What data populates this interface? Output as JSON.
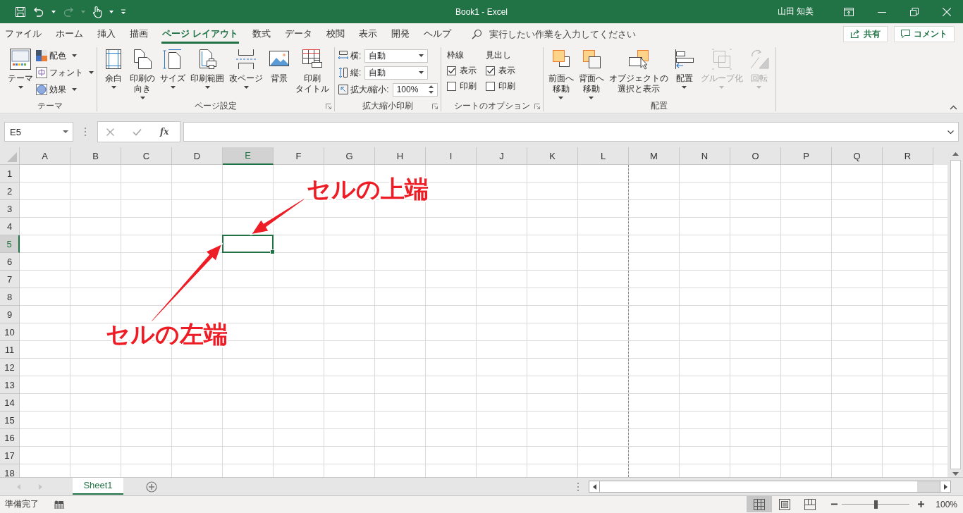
{
  "window": {
    "title": "Book1  -  Excel",
    "user": "山田 知美"
  },
  "ribbon_tabs": [
    {
      "label": "ファイル",
      "selected": false
    },
    {
      "label": "ホーム",
      "selected": false
    },
    {
      "label": "挿入",
      "selected": false
    },
    {
      "label": "描画",
      "selected": false
    },
    {
      "label": "ページ レイアウト",
      "selected": true
    },
    {
      "label": "数式",
      "selected": false
    },
    {
      "label": "データ",
      "selected": false
    },
    {
      "label": "校閲",
      "selected": false
    },
    {
      "label": "表示",
      "selected": false
    },
    {
      "label": "開発",
      "selected": false
    },
    {
      "label": "ヘルプ",
      "selected": false
    }
  ],
  "tell_me": {
    "placeholder": "実行したい作業を入力してください"
  },
  "share_button": "共有",
  "comment_button": "コメント",
  "ribbon_groups": [
    {
      "label": "テーマ",
      "launcher": false,
      "items": [
        {
          "kind": "large",
          "lines": [
            "テーマ"
          ],
          "dropdown": true,
          "disabled": false
        },
        {
          "kind": "stack",
          "items": [
            {
              "kind": "small",
              "label": "配色",
              "dropdown": true
            },
            {
              "kind": "small",
              "label": "フォント",
              "dropdown": true
            },
            {
              "kind": "small",
              "label": "効果",
              "dropdown": true
            }
          ]
        }
      ]
    },
    {
      "label": "ページ設定",
      "launcher": true,
      "items": [
        {
          "kind": "large",
          "lines": [
            "余白"
          ],
          "dropdown": true,
          "disabled": false
        },
        {
          "kind": "large",
          "lines": [
            "印刷の",
            "向き"
          ],
          "dropdown": true,
          "disabled": false
        },
        {
          "kind": "large",
          "lines": [
            "サイズ"
          ],
          "dropdown": true,
          "disabled": false
        },
        {
          "kind": "large",
          "lines": [
            "印刷範囲"
          ],
          "dropdown": true,
          "disabled": false
        },
        {
          "kind": "large",
          "lines": [
            "改ページ"
          ],
          "dropdown": true,
          "disabled": false
        },
        {
          "kind": "large",
          "lines": [
            "背景"
          ],
          "dropdown": false,
          "disabled": false
        },
        {
          "kind": "large",
          "lines": [
            "印刷",
            "タイトル"
          ],
          "dropdown": false,
          "disabled": false
        }
      ]
    },
    {
      "label": "拡大縮小印刷",
      "launcher": true,
      "items": [
        {
          "kind": "stack",
          "items": [
            {
              "kind": "field",
              "label": "横:",
              "value": "自動",
              "spin": false
            },
            {
              "kind": "field",
              "label": "縦:",
              "value": "自動",
              "spin": false
            },
            {
              "kind": "field",
              "label": "拡大/縮小:",
              "value": "100%",
              "spin": true
            }
          ]
        }
      ]
    },
    {
      "label": "シートのオプション",
      "launcher": true,
      "items": [
        {
          "kind": "checks",
          "heading": "枠線",
          "options": [
            {
              "label": "表示",
              "checked": true
            },
            {
              "label": "印刷",
              "checked": false
            }
          ]
        },
        {
          "kind": "checks",
          "heading": "見出し",
          "options": [
            {
              "label": "表示",
              "checked": true
            },
            {
              "label": "印刷",
              "checked": false
            }
          ]
        }
      ]
    },
    {
      "label": "配置",
      "launcher": false,
      "items": [
        {
          "kind": "large",
          "lines": [
            "前面へ",
            "移動"
          ],
          "dropdown": true,
          "disabled": false
        },
        {
          "kind": "large",
          "lines": [
            "背面へ",
            "移動"
          ],
          "dropdown": true,
          "disabled": false
        },
        {
          "kind": "large",
          "lines": [
            "オブジェクトの",
            "選択と表示"
          ],
          "dropdown": false,
          "disabled": false
        },
        {
          "kind": "large",
          "lines": [
            "配置"
          ],
          "dropdown": true,
          "disabled": false
        },
        {
          "kind": "large",
          "lines": [
            "グループ化"
          ],
          "dropdown": true,
          "disabled": true
        },
        {
          "kind": "large",
          "lines": [
            "回転"
          ],
          "dropdown": true,
          "disabled": true
        }
      ]
    }
  ],
  "formula_bar": {
    "name_box": "E5",
    "function_button": "fx"
  },
  "sheet": {
    "columns": [
      {
        "label": "A",
        "selected": false,
        "page_break": false
      },
      {
        "label": "B",
        "selected": false,
        "page_break": false
      },
      {
        "label": "C",
        "selected": false,
        "page_break": false
      },
      {
        "label": "D",
        "selected": false,
        "page_break": false
      },
      {
        "label": "E",
        "selected": true,
        "page_break": false
      },
      {
        "label": "F",
        "selected": false,
        "page_break": false
      },
      {
        "label": "G",
        "selected": false,
        "page_break": false
      },
      {
        "label": "H",
        "selected": false,
        "page_break": false
      },
      {
        "label": "I",
        "selected": false,
        "page_break": false
      },
      {
        "label": "J",
        "selected": false,
        "page_break": false
      },
      {
        "label": "K",
        "selected": false,
        "page_break": false
      },
      {
        "label": "L",
        "selected": false,
        "page_break": true
      },
      {
        "label": "M",
        "selected": false,
        "page_break": false
      },
      {
        "label": "N",
        "selected": false,
        "page_break": false
      },
      {
        "label": "O",
        "selected": false,
        "page_break": false
      },
      {
        "label": "P",
        "selected": false,
        "page_break": false
      },
      {
        "label": "Q",
        "selected": false,
        "page_break": false
      },
      {
        "label": "R",
        "selected": false,
        "page_break": false
      }
    ],
    "rows": [
      {
        "label": "1",
        "selected": false
      },
      {
        "label": "2",
        "selected": false
      },
      {
        "label": "3",
        "selected": false
      },
      {
        "label": "4",
        "selected": false
      },
      {
        "label": "5",
        "selected": true
      },
      {
        "label": "6",
        "selected": false
      },
      {
        "label": "7",
        "selected": false
      },
      {
        "label": "8",
        "selected": false
      },
      {
        "label": "9",
        "selected": false
      },
      {
        "label": "10",
        "selected": false
      },
      {
        "label": "11",
        "selected": false
      },
      {
        "label": "12",
        "selected": false
      },
      {
        "label": "13",
        "selected": false
      },
      {
        "label": "14",
        "selected": false
      },
      {
        "label": "15",
        "selected": false
      },
      {
        "label": "16",
        "selected": false
      },
      {
        "label": "17",
        "selected": false
      },
      {
        "label": "18",
        "selected": false
      }
    ]
  },
  "annotations": [
    {
      "text": "セルの上端"
    },
    {
      "text": "セルの左端"
    }
  ],
  "sheet_tabs": [
    {
      "label": "Sheet1",
      "selected": true
    }
  ],
  "status_bar": {
    "status": "準備完了",
    "views": [
      {
        "selected": true
      },
      {
        "selected": false
      },
      {
        "selected": false
      }
    ],
    "zoom": {
      "level": 0.5,
      "reading": "100%"
    }
  }
}
